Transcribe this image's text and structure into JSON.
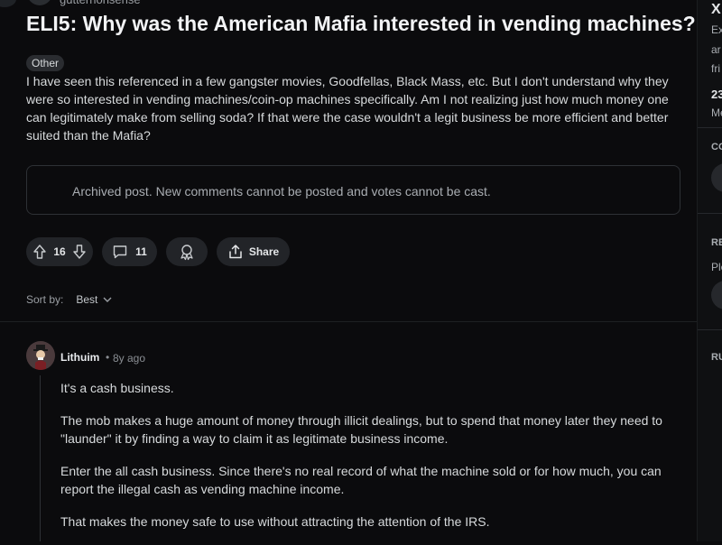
{
  "post": {
    "author": "gutternonsense",
    "title": "ELI5: Why was the American Mafia interested in vending machines?",
    "flair": "Other",
    "body": "I have seen this referenced in a few gangster movies, Goodfellas, Black Mass, etc. But I don't understand why they were so interested in vending machines/coin-op machines specifically. Am I not realizing just how much money one can legitimately make from selling soda? If that were the case wouldn't a legit business be more efficient and better suited than the Mafia?",
    "archived_notice": "Archived post. New comments cannot be posted and votes cannot be cast.",
    "upvotes": "16",
    "comments": "11",
    "share_label": "Share"
  },
  "sort": {
    "label": "Sort by:",
    "value": "Best"
  },
  "comment": {
    "author": "Lithuim",
    "separator": "•",
    "time": "8y ago",
    "paragraphs": [
      "It's a cash business.",
      "The mob makes a huge amount of money through illicit dealings, but to spend that money later they need to \"launder\" it by finding a way to claim it as legitimate business income.",
      "Enter the all cash business. Since there's no real record of what the machine sold or for how much, you can report the illegal cash as vending machine income.",
      "That makes the money safe to use without attracting the attention of the IRS."
    ]
  },
  "sidebar": {
    "close": "X",
    "line1": "Ex",
    "line2": "ar",
    "line3": "fri",
    "stat": "23",
    "stat_label": "Me",
    "section1": "CO",
    "section2": "RE",
    "section2_text": "Ple",
    "section3": "RU"
  },
  "colors": {
    "background": "#0b0b0d",
    "pill": "#222428",
    "text": "#d7dadc"
  }
}
